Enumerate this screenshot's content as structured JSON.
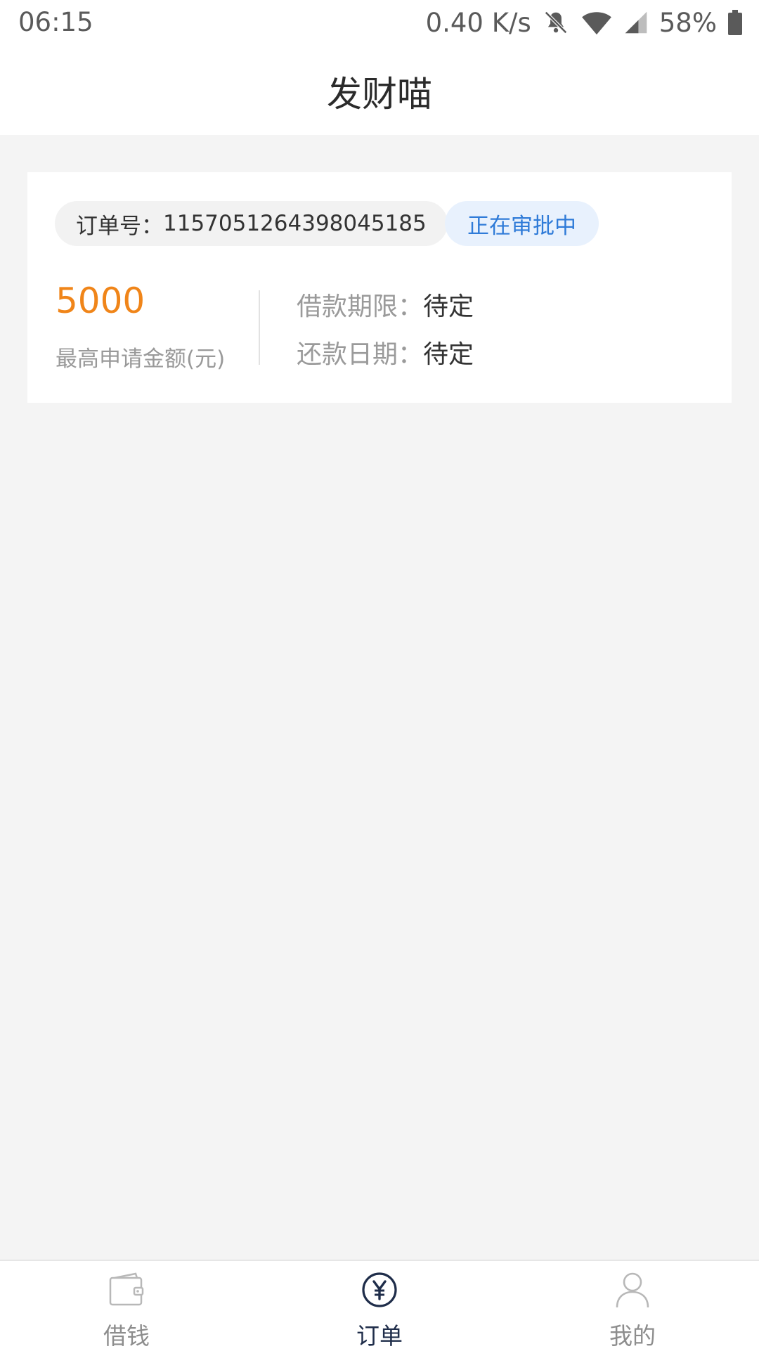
{
  "status_bar": {
    "time": "06:15",
    "network_speed": "0.40 K/s",
    "battery": "58%"
  },
  "header": {
    "title": "发财喵"
  },
  "order": {
    "order_no_label": "订单号：",
    "order_no": "1157051264398045185",
    "status": "正在审批中",
    "amount": "5000",
    "amount_label": "最高申请金额(元)",
    "term_label": "借款期限：",
    "term_value": "待定",
    "repay_label": "还款日期：",
    "repay_value": "待定"
  },
  "colors": {
    "accent_orange": "#f08519",
    "status_blue": "#2f7bd8",
    "nav_active": "#1f2d4a"
  },
  "bottom_nav": {
    "items": [
      {
        "label": "借钱",
        "icon": "wallet-icon"
      },
      {
        "label": "订单",
        "icon": "yen-icon"
      },
      {
        "label": "我的",
        "icon": "user-icon"
      }
    ],
    "active": "订单"
  }
}
